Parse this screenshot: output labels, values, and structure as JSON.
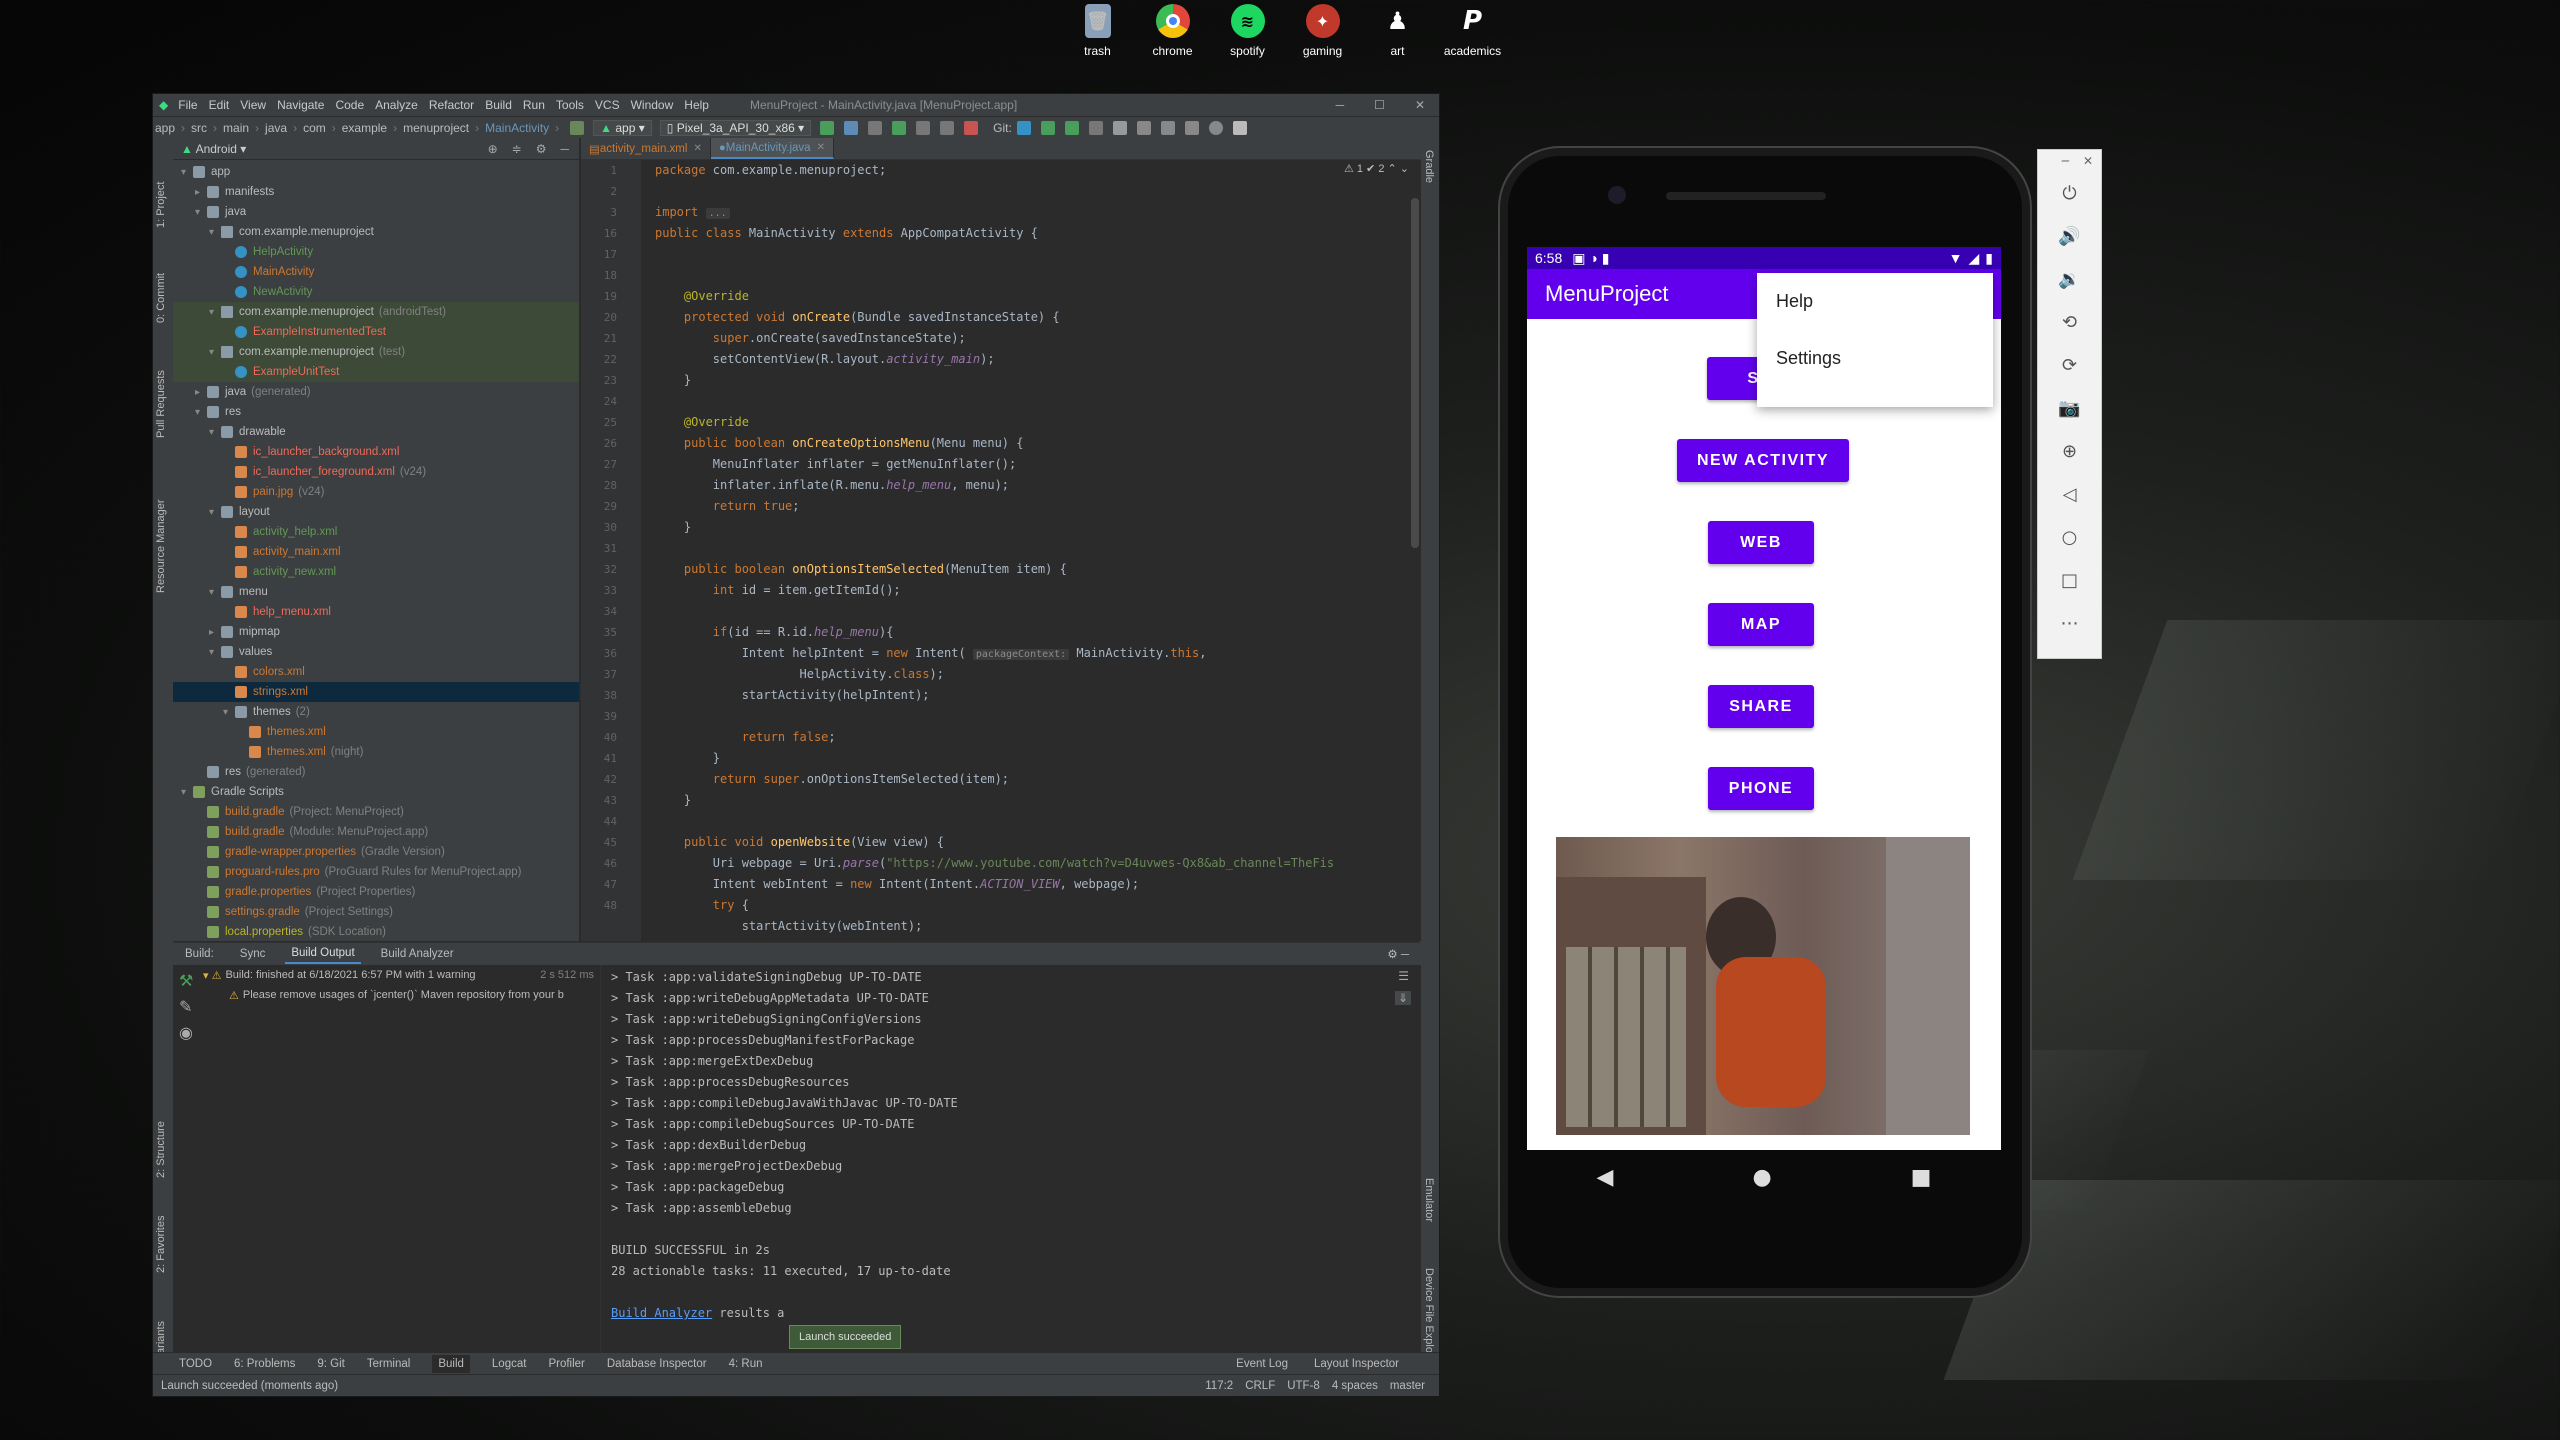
{
  "desktop": {
    "icons": [
      {
        "label": "trash",
        "icon": "trash-icon",
        "color": "#8aa0b8"
      },
      {
        "label": "chrome",
        "icon": "chrome-icon",
        "color": "#e0463a"
      },
      {
        "label": "spotify",
        "icon": "spotify-icon",
        "color": "#1ed760"
      },
      {
        "label": "gaming",
        "icon": "gaming-icon",
        "color": "#c0392b"
      },
      {
        "label": "art",
        "icon": "art-icon",
        "color": "#dddddd"
      },
      {
        "label": "academics",
        "icon": "academics-icon",
        "color": "#ffffff"
      }
    ]
  },
  "ide": {
    "menu": [
      "File",
      "Edit",
      "View",
      "Navigate",
      "Code",
      "Analyze",
      "Refactor",
      "Build",
      "Run",
      "Tools",
      "VCS",
      "Window",
      "Help"
    ],
    "window_title": "MenuProject - MainActivity.java [MenuProject.app]",
    "breadcrumbs": [
      "app",
      "src",
      "main",
      "java",
      "com",
      "example",
      "menuproject",
      "MainActivity"
    ],
    "run_config": "app",
    "device": "Pixel_3a_API_30_x86",
    "git_label": "Git:",
    "left_strip": [
      "1: Project",
      "0: Commit",
      "Pull Requests",
      "Resource Manager",
      "2: Structure",
      "2: Favorites",
      "Build Variants"
    ],
    "right_strip": [
      "Gradle",
      "Emulator",
      "Device File Explorer"
    ],
    "project": {
      "view": "Android",
      "tree": [
        {
          "indent": 0,
          "arrow": "▾",
          "icon": "folder",
          "label": "app",
          "cls": ""
        },
        {
          "indent": 1,
          "arrow": "▸",
          "icon": "folder",
          "label": "manifests",
          "cls": ""
        },
        {
          "indent": 1,
          "arrow": "▾",
          "icon": "folder",
          "label": "java",
          "cls": ""
        },
        {
          "indent": 2,
          "arrow": "▾",
          "icon": "pkg",
          "label": "com.example.menuproject",
          "cls": ""
        },
        {
          "indent": 3,
          "arrow": "",
          "icon": "cls",
          "label": "HelpActivity",
          "cls": "c-green"
        },
        {
          "indent": 3,
          "arrow": "",
          "icon": "cls",
          "label": "MainActivity",
          "cls": "c-orange"
        },
        {
          "indent": 3,
          "arrow": "",
          "icon": "cls",
          "label": "NewActivity",
          "cls": "c-green"
        },
        {
          "indent": 2,
          "arrow": "▾",
          "icon": "pkg",
          "label": "com.example.menuproject",
          "hint": "(androidTest)",
          "cls": "",
          "row": "row-test"
        },
        {
          "indent": 3,
          "arrow": "",
          "icon": "cls",
          "label": "ExampleInstrumentedTest",
          "cls": "c-red",
          "row": "row-test"
        },
        {
          "indent": 2,
          "arrow": "▾",
          "icon": "pkg",
          "label": "com.example.menuproject",
          "hint": "(test)",
          "cls": "",
          "row": "row-test"
        },
        {
          "indent": 3,
          "arrow": "",
          "icon": "cls",
          "label": "ExampleUnitTest",
          "cls": "c-red",
          "row": "row-test"
        },
        {
          "indent": 1,
          "arrow": "▸",
          "icon": "folder",
          "label": "java",
          "hint": "(generated)",
          "cls": ""
        },
        {
          "indent": 1,
          "arrow": "▾",
          "icon": "folder",
          "label": "res",
          "cls": ""
        },
        {
          "indent": 2,
          "arrow": "▾",
          "icon": "folder",
          "label": "drawable",
          "cls": ""
        },
        {
          "indent": 3,
          "arrow": "",
          "icon": "xml",
          "label": "ic_launcher_background.xml",
          "cls": "c-red"
        },
        {
          "indent": 3,
          "arrow": "",
          "icon": "xml",
          "label": "ic_launcher_foreground.xml",
          "hint": "(v24)",
          "cls": "c-red"
        },
        {
          "indent": 3,
          "arrow": "",
          "icon": "img",
          "label": "pain.jpg",
          "hint": "(v24)",
          "cls": "c-orange"
        },
        {
          "indent": 2,
          "arrow": "▾",
          "icon": "folder",
          "label": "layout",
          "cls": ""
        },
        {
          "indent": 3,
          "arrow": "",
          "icon": "xml",
          "label": "activity_help.xml",
          "cls": "c-green"
        },
        {
          "indent": 3,
          "arrow": "",
          "icon": "xml",
          "label": "activity_main.xml",
          "cls": "c-orange"
        },
        {
          "indent": 3,
          "arrow": "",
          "icon": "xml",
          "label": "activity_new.xml",
          "cls": "c-green"
        },
        {
          "indent": 2,
          "arrow": "▾",
          "icon": "folder",
          "label": "menu",
          "cls": ""
        },
        {
          "indent": 3,
          "arrow": "",
          "icon": "xml",
          "label": "help_menu.xml",
          "cls": "c-red"
        },
        {
          "indent": 2,
          "arrow": "▸",
          "icon": "folder",
          "label": "mipmap",
          "cls": ""
        },
        {
          "indent": 2,
          "arrow": "▾",
          "icon": "folder",
          "label": "values",
          "cls": ""
        },
        {
          "indent": 3,
          "arrow": "",
          "icon": "xml",
          "label": "colors.xml",
          "cls": "c-orange"
        },
        {
          "indent": 3,
          "arrow": "",
          "icon": "xml",
          "label": "strings.xml",
          "cls": "c-orange",
          "row": "row-sel"
        },
        {
          "indent": 3,
          "arrow": "▾",
          "icon": "folder",
          "label": "themes",
          "hint": "(2)",
          "cls": ""
        },
        {
          "indent": 4,
          "arrow": "",
          "icon": "xml",
          "label": "themes.xml",
          "cls": "c-orange"
        },
        {
          "indent": 4,
          "arrow": "",
          "icon": "xml",
          "label": "themes.xml",
          "hint": "(night)",
          "cls": "c-orange"
        },
        {
          "indent": 1,
          "arrow": "",
          "icon": "folder",
          "label": "res",
          "hint": "(generated)",
          "cls": ""
        },
        {
          "indent": 0,
          "arrow": "▾",
          "icon": "grad",
          "label": "Gradle Scripts",
          "cls": ""
        },
        {
          "indent": 1,
          "arrow": "",
          "icon": "grad",
          "label": "build.gradle",
          "hint": "(Project: MenuProject)",
          "cls": "c-orange"
        },
        {
          "indent": 1,
          "arrow": "",
          "icon": "grad",
          "label": "build.gradle",
          "hint": "(Module: MenuProject.app)",
          "cls": "c-orange"
        },
        {
          "indent": 1,
          "arrow": "",
          "icon": "grad",
          "label": "gradle-wrapper.properties",
          "hint": "(Gradle Version)",
          "cls": "c-orange"
        },
        {
          "indent": 1,
          "arrow": "",
          "icon": "grad",
          "label": "proguard-rules.pro",
          "hint": "(ProGuard Rules for MenuProject.app)",
          "cls": "c-orange"
        },
        {
          "indent": 1,
          "arrow": "",
          "icon": "grad",
          "label": "gradle.properties",
          "hint": "(Project Properties)",
          "cls": "c-orange"
        },
        {
          "indent": 1,
          "arrow": "",
          "icon": "grad",
          "label": "settings.gradle",
          "hint": "(Project Settings)",
          "cls": "c-orange"
        },
        {
          "indent": 1,
          "arrow": "",
          "icon": "grad",
          "label": "local.properties",
          "hint": "(SDK Location)",
          "cls": "c-yellow"
        }
      ]
    },
    "editor_tabs": [
      {
        "label": "activity_main.xml",
        "active": false
      },
      {
        "label": "MainActivity.java",
        "active": true
      }
    ],
    "warnings": "⚠ 1  ✔ 2",
    "line_numbers": [
      "1",
      "2",
      "3",
      "16",
      "17",
      "18",
      "19",
      "20",
      "21",
      "22",
      "23",
      "24",
      "25",
      "26",
      "27",
      "28",
      "29",
      "30",
      "31",
      "32",
      "33",
      "34",
      "35",
      "36",
      "37",
      "38",
      "39",
      "40",
      "41",
      "42",
      "43",
      "44",
      "45",
      "46",
      "47",
      "48"
    ],
    "code_lines": [
      [
        [
          "kw",
          "package "
        ],
        [
          "",
          "com.example.menuproject;"
        ]
      ],
      [
        [
          "",
          ""
        ]
      ],
      [
        [
          "kw",
          "import "
        ],
        [
          "hint-inline",
          "..."
        ]
      ],
      [
        [
          "kw",
          "public class "
        ],
        [
          "",
          "MainActivity "
        ],
        [
          "kw",
          "extends "
        ],
        [
          "",
          "AppCompatActivity {"
        ]
      ],
      [
        [
          "",
          ""
        ]
      ],
      [
        [
          "",
          ""
        ]
      ],
      [
        [
          "an",
          "    @Override"
        ]
      ],
      [
        [
          "kw",
          "    protected void "
        ],
        [
          "fn",
          "onCreate"
        ],
        [
          "",
          "(Bundle savedInstanceState) {"
        ]
      ],
      [
        [
          "kw",
          "        super"
        ],
        [
          "",
          "."
        ],
        [
          "",
          "onCreate(savedInstanceState);"
        ]
      ],
      [
        [
          "",
          "        setContentView(R.layout."
        ],
        [
          "it",
          "activity_main"
        ],
        [
          "",
          ");"
        ]
      ],
      [
        [
          "",
          "    }"
        ]
      ],
      [
        [
          "",
          ""
        ]
      ],
      [
        [
          "an",
          "    @Override"
        ]
      ],
      [
        [
          "kw",
          "    public boolean "
        ],
        [
          "fn",
          "onCreateOptionsMenu"
        ],
        [
          "",
          "(Menu menu) {"
        ]
      ],
      [
        [
          "",
          "        MenuInflater inflater = getMenuInflater();"
        ]
      ],
      [
        [
          "",
          "        inflater.inflate(R.menu."
        ],
        [
          "it",
          "help_menu"
        ],
        [
          "",
          ", menu);"
        ]
      ],
      [
        [
          "kw",
          "        return true"
        ],
        [
          "",
          ";"
        ]
      ],
      [
        [
          "",
          "    }"
        ]
      ],
      [
        [
          "",
          ""
        ]
      ],
      [
        [
          "kw",
          "    public boolean "
        ],
        [
          "fn",
          "onOptionsItemSelected"
        ],
        [
          "",
          "(MenuItem item) {"
        ]
      ],
      [
        [
          "kw",
          "        int "
        ],
        [
          "",
          "id = item.getItemId();"
        ]
      ],
      [
        [
          "",
          ""
        ]
      ],
      [
        [
          "kw",
          "        if"
        ],
        [
          "",
          "(id == R.id."
        ],
        [
          "it",
          "help_menu"
        ],
        [
          "",
          "){"
        ]
      ],
      [
        [
          "",
          "            Intent helpIntent = "
        ],
        [
          "kw",
          "new "
        ],
        [
          "",
          "Intent( "
        ],
        [
          "hint-inline",
          "packageContext:"
        ],
        [
          "",
          " MainActivity."
        ],
        [
          "kw",
          "this"
        ],
        [
          "",
          ","
        ]
      ],
      [
        [
          "",
          "                    HelpActivity."
        ],
        [
          "kw",
          "class"
        ],
        [
          "",
          ");"
        ]
      ],
      [
        [
          "",
          "            startActivity(helpIntent);"
        ]
      ],
      [
        [
          "",
          ""
        ]
      ],
      [
        [
          "kw",
          "            return false"
        ],
        [
          "",
          ";"
        ]
      ],
      [
        [
          "",
          "        }"
        ]
      ],
      [
        [
          "kw",
          "        return super"
        ],
        [
          "",
          ".onOptionsItemSelected(item);"
        ]
      ],
      [
        [
          "",
          "    }"
        ]
      ],
      [
        [
          "",
          ""
        ]
      ],
      [
        [
          "kw",
          "    public void "
        ],
        [
          "fn",
          "openWebsite"
        ],
        [
          "",
          "(View view) {"
        ]
      ],
      [
        [
          "",
          "        Uri webpage = Uri."
        ],
        [
          "it",
          "parse"
        ],
        [
          "",
          "("
        ],
        [
          "str",
          "\"https://www.youtube.com/watch?v=D4uvwes-Qx8&ab_channel=TheFis"
        ]
      ],
      [
        [
          "",
          "        Intent webIntent = "
        ],
        [
          "kw",
          "new "
        ],
        [
          "",
          "Intent(Intent."
        ],
        [
          "it",
          "ACTION_VIEW"
        ],
        [
          "",
          ", webpage);"
        ]
      ],
      [
        [
          "kw",
          "        try "
        ],
        [
          "",
          "{"
        ]
      ],
      [
        [
          "",
          "            startActivity(webIntent);"
        ]
      ]
    ],
    "build": {
      "label": "Build:",
      "tabs": [
        "Sync",
        "Build Output",
        "Build Analyzer"
      ],
      "status_line": "Build: finished at 6/18/2021 6:57 PM with 1 warning",
      "status_time": "2 s 512 ms",
      "warning_line": "Please remove usages of `jcenter()` Maven repository from your b",
      "output": [
        "> Task :app:validateSigningDebug UP-TO-DATE",
        "> Task :app:writeDebugAppMetadata UP-TO-DATE",
        "> Task :app:writeDebugSigningConfigVersions",
        "> Task :app:processDebugManifestForPackage",
        "> Task :app:mergeExtDexDebug",
        "> Task :app:processDebugResources",
        "> Task :app:compileDebugJavaWithJavac UP-TO-DATE",
        "> Task :app:compileDebugSources UP-TO-DATE",
        "> Task :app:dexBuilderDebug",
        "> Task :app:mergeProjectDexDebug",
        "> Task :app:packageDebug",
        "> Task :app:assembleDebug",
        "",
        "BUILD SUCCESSFUL in 2s",
        "28 actionable tasks: 11 executed, 17 up-to-date"
      ],
      "analyzer_link": "Build Analyzer",
      "analyzer_rest": " results a"
    },
    "toast": "Launch succeeded",
    "bottom_tabs": [
      "TODO",
      "6: Problems",
      "9: Git",
      "Terminal",
      "Build",
      "Logcat",
      "Profiler",
      "Database Inspector",
      "4: Run"
    ],
    "bottom_right": [
      "Event Log",
      "Layout Inspector"
    ],
    "status_msg": "Launch succeeded (moments ago)",
    "status_right": [
      "117:2",
      "CRLF",
      "UTF-8",
      "4 spaces",
      "master"
    ]
  },
  "phone": {
    "time": "6:58",
    "app_title": "MenuProject",
    "popup_items": [
      "Help",
      "Settings"
    ],
    "buttons": [
      "SH",
      "NEW ACTIVITY",
      "WEB",
      "MAP",
      "SHARE",
      "PHONE"
    ],
    "accent": "#6200ee",
    "statusbar_color": "#3700b3"
  }
}
